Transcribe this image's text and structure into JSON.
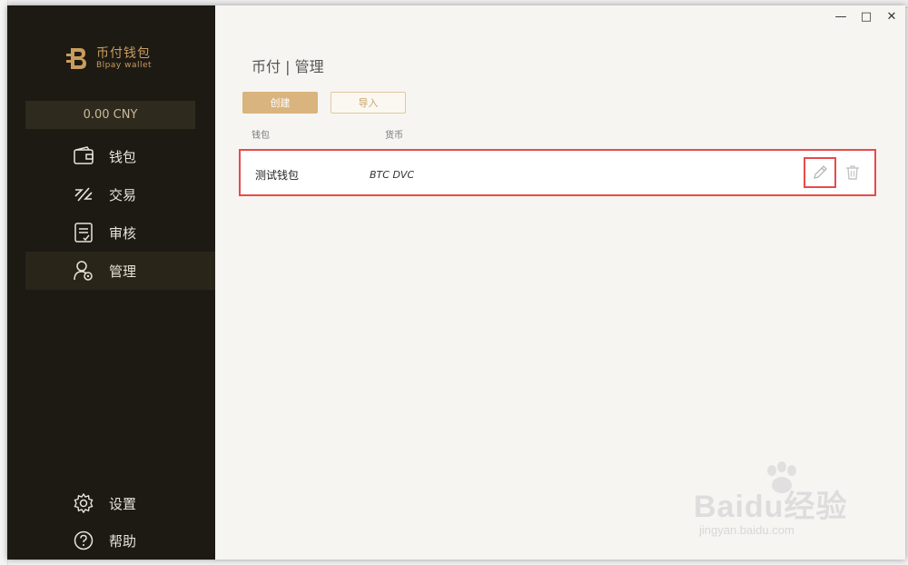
{
  "sidebar": {
    "logo_cn": "币付钱包",
    "logo_en": "Blpay wallet",
    "balance": "0.00 CNY",
    "items": [
      {
        "label": "钱包"
      },
      {
        "label": "交易"
      },
      {
        "label": "审核"
      },
      {
        "label": "管理"
      }
    ],
    "bottom_items": [
      {
        "label": "设置"
      },
      {
        "label": "帮助"
      }
    ]
  },
  "window": {
    "minimize": "—",
    "maximize": "□",
    "close": "✕"
  },
  "main": {
    "title": "币付 | 管理",
    "create_label": "创建",
    "import_label": "导入",
    "columns": [
      "钱包",
      "货币"
    ],
    "rows": [
      {
        "name": "测试钱包",
        "currency": "BTC DVC"
      }
    ]
  },
  "watermark": {
    "text": "Baidu经验",
    "sub": "jingyan.baidu.com"
  },
  "colors": {
    "sidebar_bg": "#1d1a14",
    "accent": "#d9b47e",
    "highlight": "#e84a4a"
  }
}
